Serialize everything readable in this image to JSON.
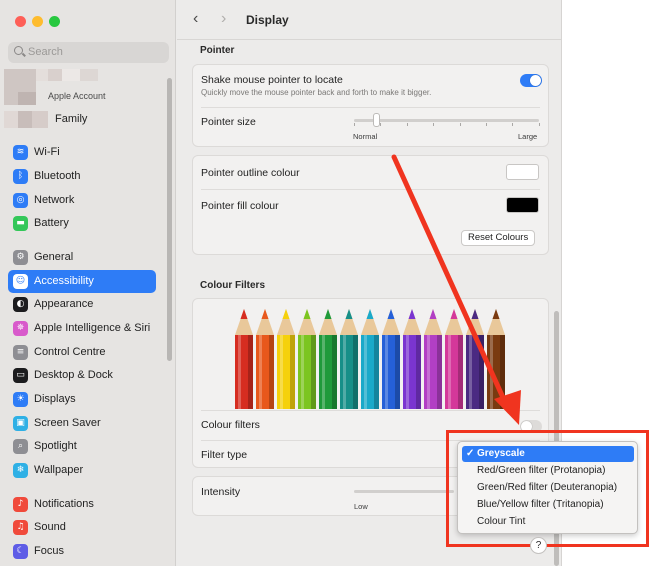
{
  "window": {
    "title": "Display"
  },
  "sidebar": {
    "search_placeholder": "Search",
    "account_label": "Apple Account",
    "family_label": "Family",
    "items": [
      {
        "label": "Wi-Fi",
        "icon": "wifi-icon",
        "color": "#2e7cf6"
      },
      {
        "label": "Bluetooth",
        "icon": "bluetooth-icon",
        "color": "#2e7cf6"
      },
      {
        "label": "Network",
        "icon": "globe-icon",
        "color": "#2e7cf6"
      },
      {
        "label": "Battery",
        "icon": "battery-icon",
        "color": "#34c759"
      },
      {
        "label": "General",
        "icon": "gear-icon",
        "color": "#8e8e93"
      },
      {
        "label": "Accessibility",
        "icon": "accessibility-icon",
        "color": "#2e7cf6",
        "active": true
      },
      {
        "label": "Appearance",
        "icon": "appearance-icon",
        "color": "#1c1c1e"
      },
      {
        "label": "Apple Intelligence & Siri",
        "icon": "siri-icon",
        "color": "#d85acb"
      },
      {
        "label": "Control Centre",
        "icon": "control-centre-icon",
        "color": "#8e8e93"
      },
      {
        "label": "Desktop & Dock",
        "icon": "dock-icon",
        "color": "#1c1c1e"
      },
      {
        "label": "Displays",
        "icon": "sun-icon",
        "color": "#2e7cf6"
      },
      {
        "label": "Screen Saver",
        "icon": "screensaver-icon",
        "color": "#2fb0e5"
      },
      {
        "label": "Spotlight",
        "icon": "spotlight-icon",
        "color": "#8e8e93"
      },
      {
        "label": "Wallpaper",
        "icon": "wallpaper-icon",
        "color": "#2fb0e5"
      },
      {
        "label": "Notifications",
        "icon": "bell-icon",
        "color": "#f04a3b"
      },
      {
        "label": "Sound",
        "icon": "speaker-icon",
        "color": "#f04a3b"
      },
      {
        "label": "Focus",
        "icon": "moon-icon",
        "color": "#5e5ce6"
      }
    ]
  },
  "pointer": {
    "heading": "Pointer",
    "shake_label": "Shake mouse pointer to locate",
    "shake_desc": "Quickly move the mouse pointer back and forth to make it bigger.",
    "shake_on": true,
    "size_label": "Pointer size",
    "size_min": "Normal",
    "size_max": "Large",
    "size_value": 0.12,
    "outline_label": "Pointer outline colour",
    "outline_color": "#ffffff",
    "fill_label": "Pointer fill colour",
    "fill_color": "#000000",
    "reset_label": "Reset Colours"
  },
  "filters": {
    "heading": "Colour Filters",
    "enable_label": "Colour filters",
    "enable_on": false,
    "type_label": "Filter type",
    "intensity_label": "Intensity",
    "intensity_min": "Low",
    "pencil_colors": [
      "#d62d20",
      "#e8581c",
      "#f5d10c",
      "#7cc520",
      "#1f9a3a",
      "#178f88",
      "#1aa9c9",
      "#2560d8",
      "#7a35d0",
      "#b23fc4",
      "#d4389a",
      "#4b2a82",
      "#7a3a10"
    ],
    "options": [
      {
        "label": "Greyscale",
        "selected": true
      },
      {
        "label": "Red/Green filter (Protanopia)",
        "selected": false
      },
      {
        "label": "Green/Red filter (Deuteranopia)",
        "selected": false
      },
      {
        "label": "Blue/Yellow filter (Tritanopia)",
        "selected": false
      },
      {
        "label": "Colour Tint",
        "selected": false
      }
    ],
    "check_glyph": "✓"
  },
  "help_label": "?",
  "annotation_color": "#f0341f"
}
